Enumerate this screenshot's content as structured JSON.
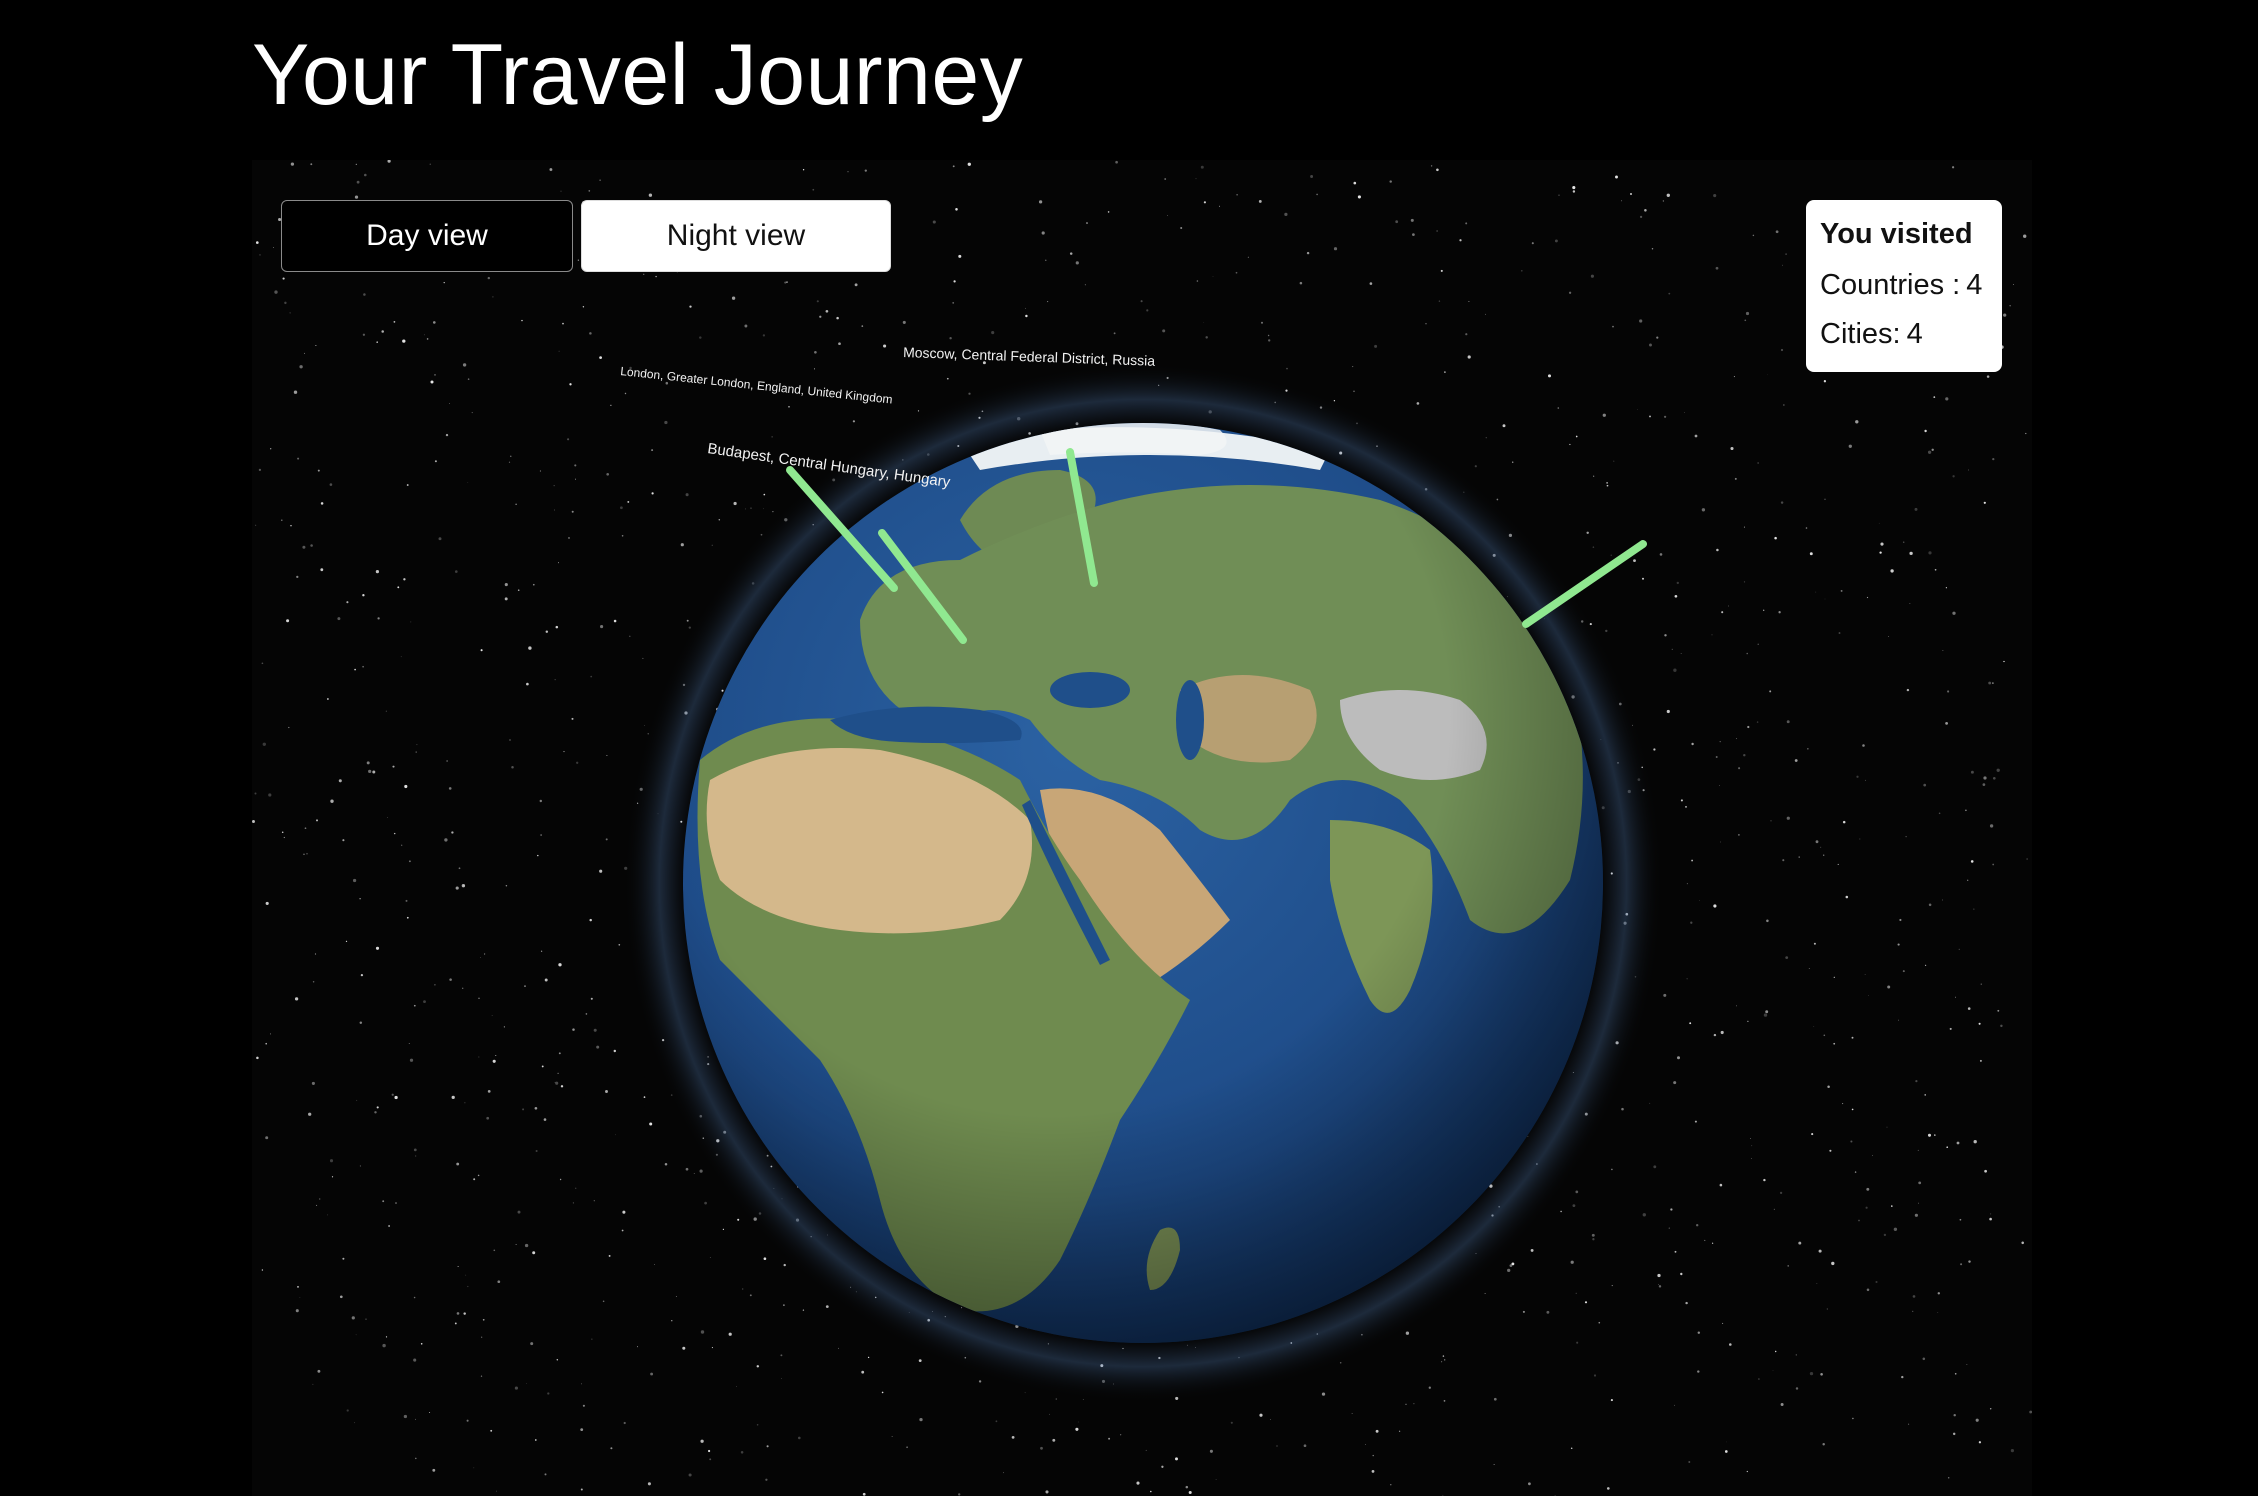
{
  "page": {
    "title": "Your Travel Journey"
  },
  "view_toggle": {
    "day_label": "Day view",
    "night_label": "Night view",
    "selected": "Night view"
  },
  "stats": {
    "header": "You visited",
    "countries_label": "Countries :",
    "countries_value": "4",
    "cities_label": "Cities:",
    "cities_value": "4"
  },
  "globe": {
    "markers": [
      {
        "label": "London, Greater London, England, United Kingdom"
      },
      {
        "label": "Budapest, Central Hungary, Hungary"
      },
      {
        "label": "Moscow, Central Federal District, Russia"
      },
      {
        "label": ""
      }
    ],
    "marker_color": "#90e890",
    "ocean_color": "#1f4f8a",
    "land_color": "#6f8f55",
    "desert_color": "#c9a878"
  }
}
